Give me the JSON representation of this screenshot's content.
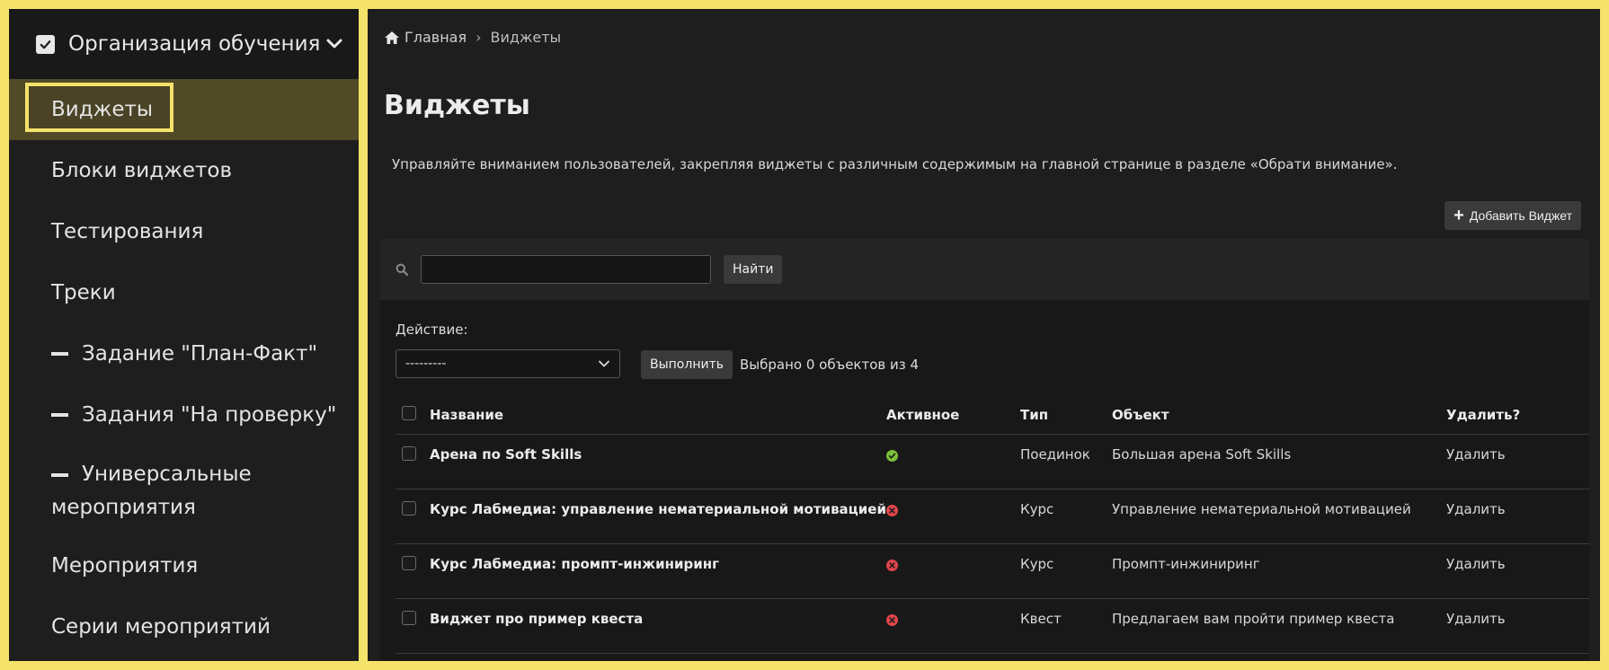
{
  "sidebar": {
    "header": "Организация обучения",
    "items": [
      {
        "label": "Виджеты",
        "active": true
      },
      {
        "label": "Блоки виджетов"
      },
      {
        "label": "Тестирования"
      },
      {
        "label": "Треки"
      },
      {
        "label": "Задание \"План-Факт\"",
        "dash": true
      },
      {
        "label": "Задания \"На проверку\"",
        "dash": true
      },
      {
        "label": "Универсальные мероприятия",
        "dash": true
      },
      {
        "label": "Мероприятия"
      },
      {
        "label": "Серии мероприятий"
      }
    ]
  },
  "breadcrumb": {
    "home": "Главная",
    "separator": "›",
    "current": "Виджеты"
  },
  "page": {
    "title": "Виджеты",
    "description": "Управляйте вниманием пользователей, закрепляя виджеты с различным содержимым на главной странице в разделе «Обрати внимание».",
    "add_button": "Добавить Виджет"
  },
  "search": {
    "placeholder": "",
    "button": "Найти"
  },
  "actions": {
    "label": "Действие:",
    "selected_option": "---------",
    "execute_button": "Выполнить",
    "selected_text": "Выбрано 0 объектов из 4"
  },
  "table": {
    "headers": {
      "name": "Название",
      "active": "Активное",
      "type": "Тип",
      "object": "Объект",
      "delete": "Удалить?"
    },
    "rows": [
      {
        "name": "Арена по Soft Skills",
        "active": true,
        "type": "Поединок",
        "object": "Большая арена Soft Skills",
        "delete": "Удалить"
      },
      {
        "name": "Курс Лабмедиа: управление нематериальной мотивацией",
        "active": false,
        "type": "Курс",
        "object": "Управление нематериальной мотивацией",
        "delete": "Удалить"
      },
      {
        "name": "Курс Лабмедиа: промпт-инжиниринг",
        "active": false,
        "type": "Курс",
        "object": "Промпт-инжиниринг",
        "delete": "Удалить"
      },
      {
        "name": "Виджет про пример квеста",
        "active": false,
        "type": "Квест",
        "object": "Предлагаем вам пройти пример квеста",
        "delete": "Удалить"
      }
    ]
  },
  "colors": {
    "frame": "#f5e26b",
    "active_ok": "#7cc13a",
    "inactive": "#e0454b",
    "active_bg": "#514a26"
  }
}
